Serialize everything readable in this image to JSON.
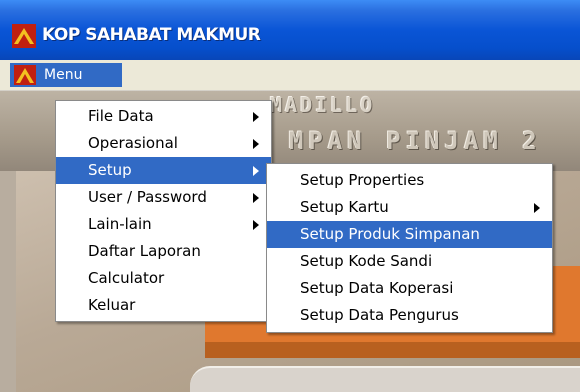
{
  "window": {
    "title": "KOP SAHABAT MAKMUR"
  },
  "menubar": {
    "root_label": "Menu"
  },
  "background": {
    "banner_line1": "MADILLO",
    "banner_line2": "- MPAN PINJAM 2"
  },
  "menu_main": {
    "items": [
      {
        "label": "File Data",
        "submenu": true,
        "highlighted": false
      },
      {
        "label": "Operasional",
        "submenu": true,
        "highlighted": false
      },
      {
        "label": "Setup",
        "submenu": true,
        "highlighted": true
      },
      {
        "label": "User / Password",
        "submenu": true,
        "highlighted": false
      },
      {
        "label": "Lain-lain",
        "submenu": true,
        "highlighted": false
      },
      {
        "label": "Daftar Laporan",
        "submenu": false,
        "highlighted": false
      },
      {
        "label": "Calculator",
        "submenu": false,
        "highlighted": false
      },
      {
        "label": "Keluar",
        "submenu": false,
        "highlighted": false
      }
    ]
  },
  "menu_setup": {
    "items": [
      {
        "label": "Setup Properties",
        "submenu": false,
        "highlighted": false
      },
      {
        "label": "Setup Kartu",
        "submenu": true,
        "highlighted": false
      },
      {
        "label": "Setup Produk Simpanan",
        "submenu": false,
        "highlighted": true
      },
      {
        "label": "Setup Kode Sandi",
        "submenu": false,
        "highlighted": false
      },
      {
        "label": "Setup Data Koperasi",
        "submenu": false,
        "highlighted": false
      },
      {
        "label": "Setup Data Pengurus",
        "submenu": false,
        "highlighted": false
      }
    ]
  },
  "colors": {
    "titlebar": "#0a55d6",
    "highlight": "#316ac5",
    "accent_orange": "#e0782e"
  }
}
